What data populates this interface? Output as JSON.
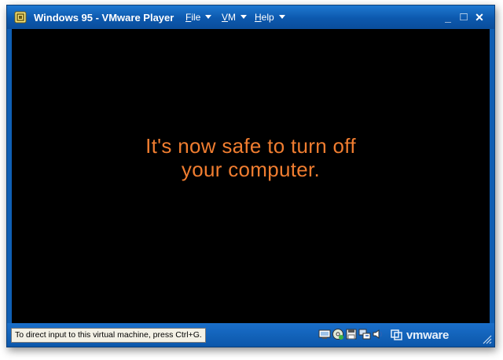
{
  "window": {
    "title": "Windows 95 - VMware Player",
    "menus": [
      {
        "label": "File",
        "accel": "F",
        "rest": "ile"
      },
      {
        "label": "VM",
        "accel": "V",
        "rest": "M"
      },
      {
        "label": "Help",
        "accel": "H",
        "rest": "elp"
      }
    ],
    "controls": {
      "minimize": "_",
      "maximize": "□",
      "close": "✕"
    }
  },
  "screen": {
    "message_line1": "It's now safe to turn off",
    "message_line2": "your computer.",
    "text_color": "#f07d30"
  },
  "statusbar": {
    "hint": "To direct input to this virtual machine, press Ctrl+G.",
    "devices": [
      "network-icon",
      "cd-drive-icon",
      "floppy-icon",
      "usb-icon",
      "sound-icon"
    ],
    "brand": "vmware"
  }
}
